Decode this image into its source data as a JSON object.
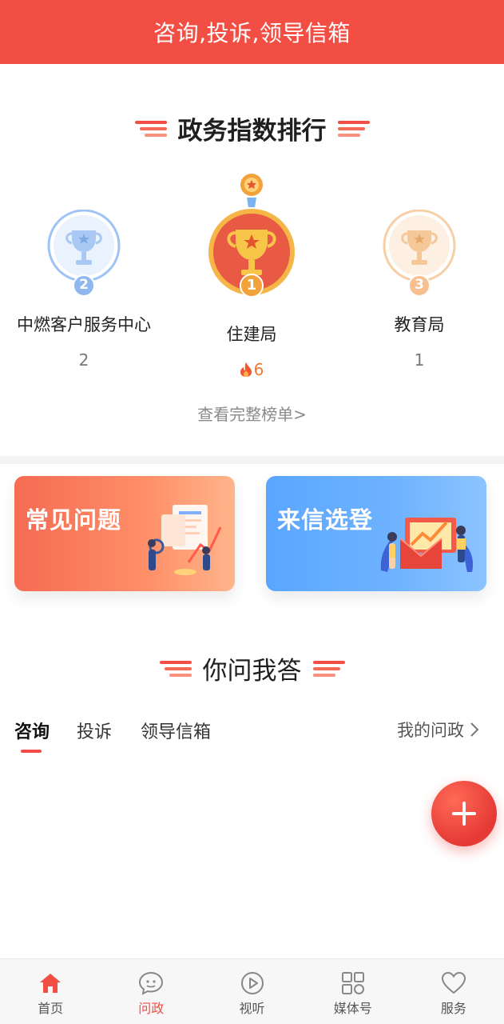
{
  "header": {
    "title": "咨询,投诉,领导信箱"
  },
  "ranking": {
    "title": "政务指数排行",
    "items": [
      {
        "rank": "2",
        "name": "中燃客户服务中心",
        "count": "2"
      },
      {
        "rank": "1",
        "name": "住建局",
        "count": "6"
      },
      {
        "rank": "3",
        "name": "教育局",
        "count": "1"
      }
    ],
    "more_label": "查看完整榜单>"
  },
  "banners": {
    "left": {
      "label": "常见问题"
    },
    "right": {
      "label": "来信选登"
    }
  },
  "qa": {
    "title": "你问我答",
    "tabs": [
      "咨询",
      "投诉",
      "领导信箱"
    ],
    "my_link": "我的问政"
  },
  "bottom_nav": [
    {
      "label": "首页",
      "icon": "home-icon"
    },
    {
      "label": "问政",
      "icon": "chat-bubble-icon",
      "active": true
    },
    {
      "label": "视听",
      "icon": "play-circle-icon"
    },
    {
      "label": "媒体号",
      "icon": "grid-icon"
    },
    {
      "label": "服务",
      "icon": "heart-icon"
    }
  ],
  "colors": {
    "brand": "#f24e44",
    "gold": "#f2a23a",
    "silver": "#8fb8f0",
    "bronze": "#f7c08e"
  }
}
